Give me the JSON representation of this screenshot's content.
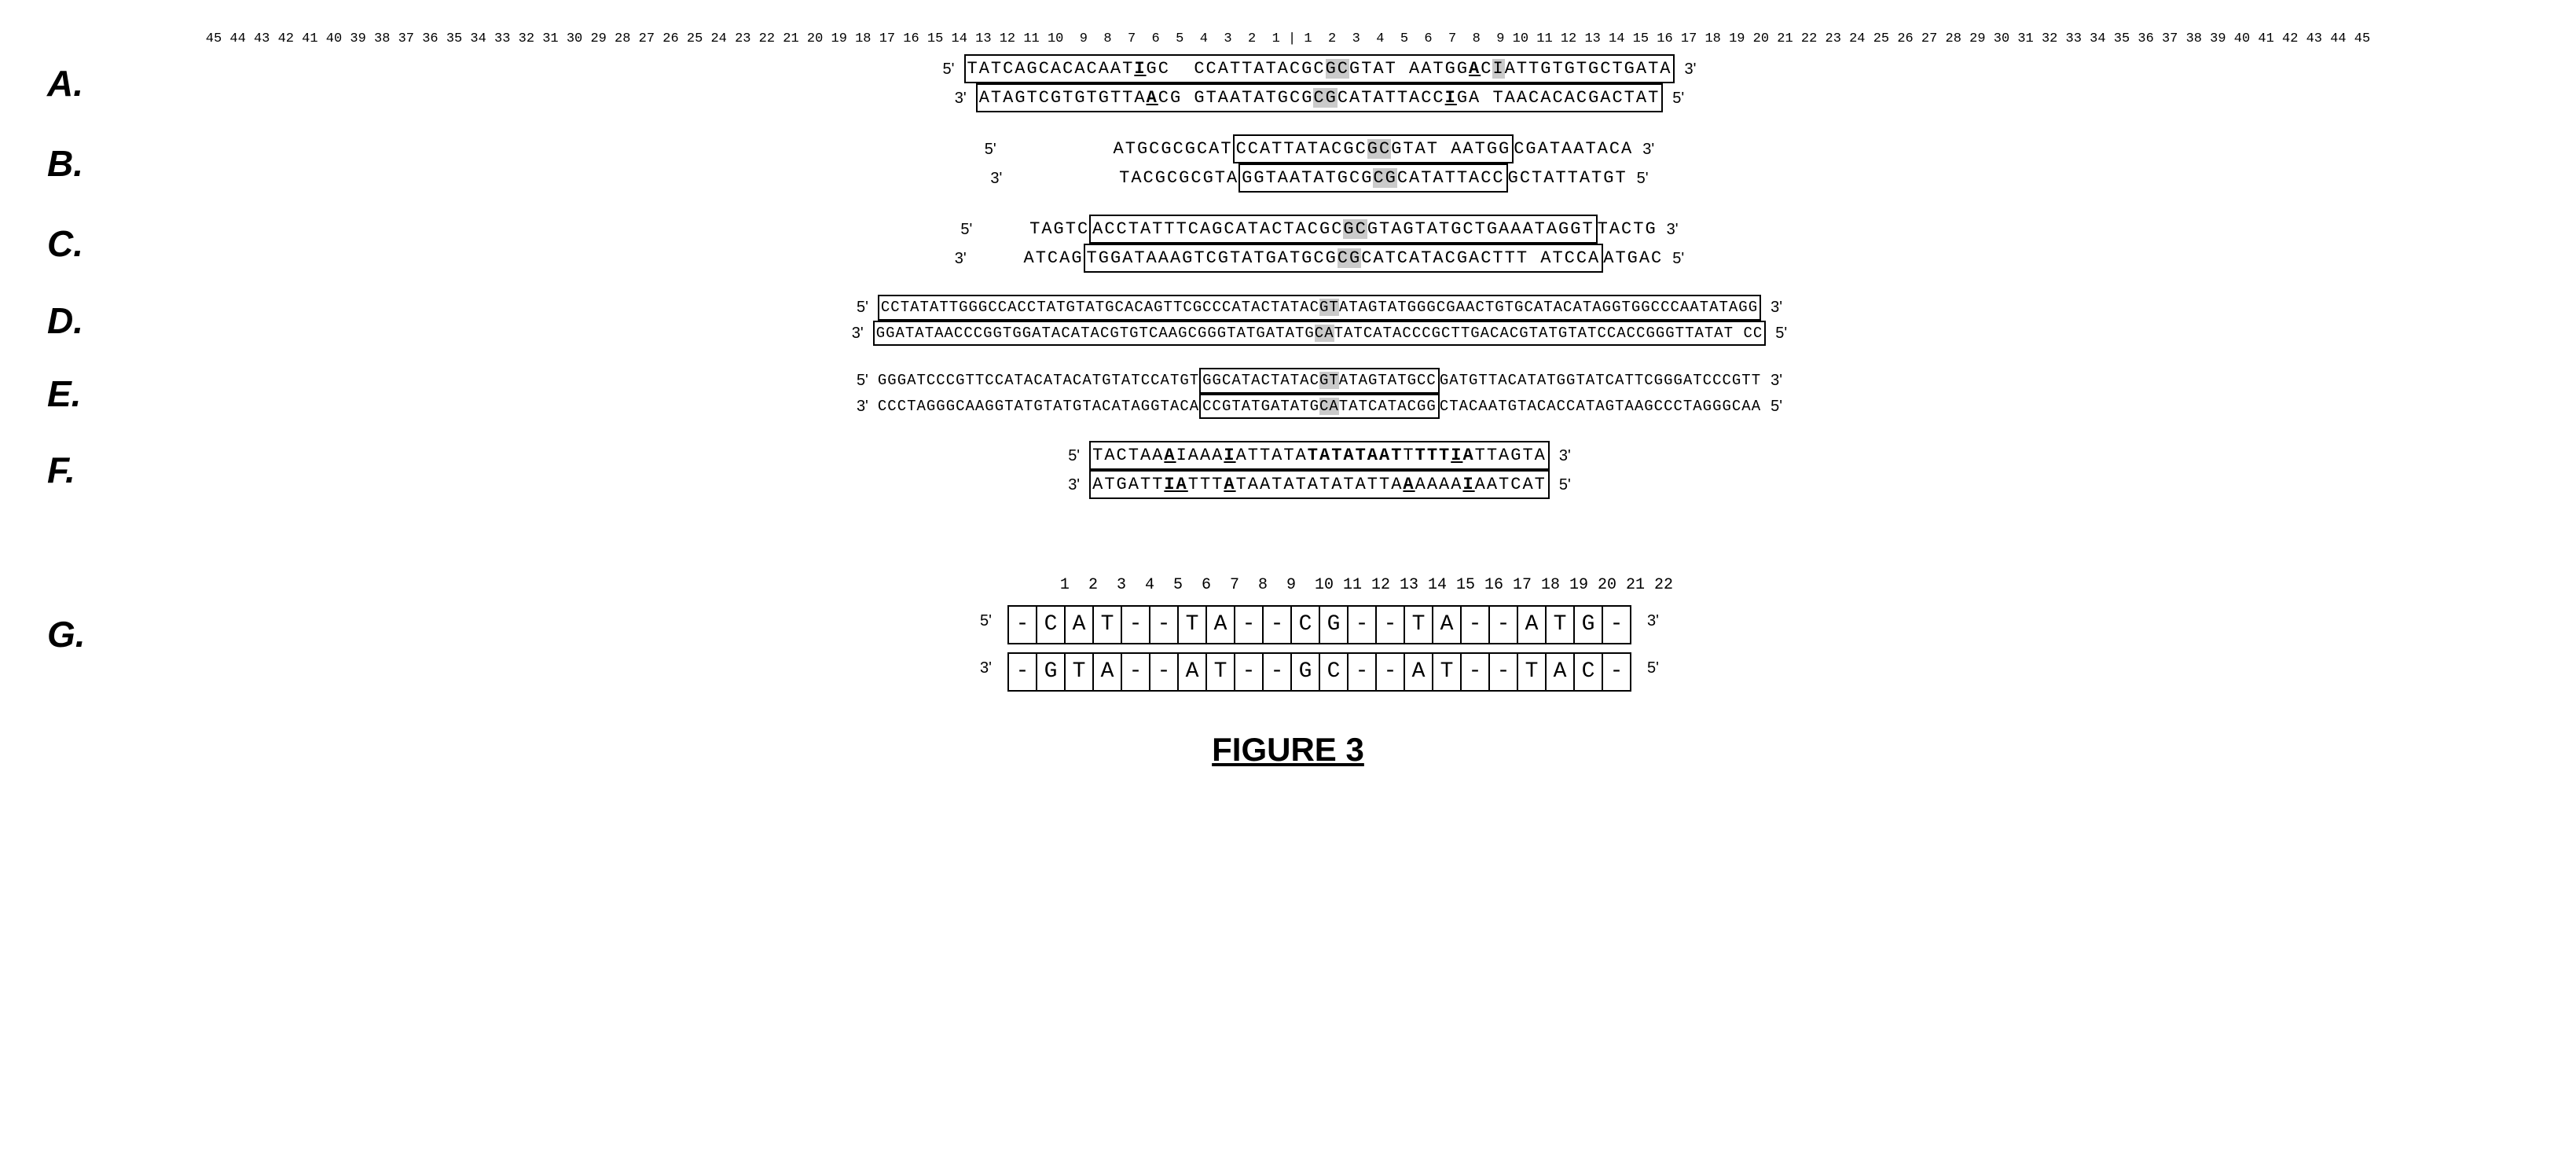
{
  "figure": {
    "title": "FIGURE 3",
    "ruler_top": "45 44 43 42 41 40 39 38 37 36 35 34 33 32 31 30 29 28 27 26 25 24 23 22 21 20 19 18 17 16 15 14 13 12 11 10  9  8  7  6  5  4  3  2  1 | 1  2  3  4  5  6  7  8  9 10 11 12 13 14 15 16 17 18 19 20 21 22 23 24 25 26 27 28 29 30 31 32 33 34 35 36 37 38 39 40 41 42 43 44 45",
    "sections": {
      "A": {
        "label": "A.",
        "top_strand": "5'   TATCAGCACACAAT|GC|CCATTATACGC|GCGTAT AATGG|AC|IATTGTGTGCTGATA   3'",
        "bottom_strand": "3'   ATAGTCGTGTGTTA|ACG|GTAATATGCGCGCATATTACC|IGA|TAACACACGACTAT   5'"
      },
      "B": {
        "label": "B.",
        "top_strand": "5'        ATGCGCGCAT|CCATTATACGC|GCGTAT AATGG|CGATAATACA   3'",
        "bottom_strand": "3'        TACGCGCGTA|GGTAATATGCGCGCATATTACC|GCTATTATGT   5'"
      },
      "C": {
        "label": "C.",
        "top_strand": "5'    TAGTC|ACCTATTTCAGCATACTACGC|GCGTAGTATGCTGAAATAGGT|TACTG   3'",
        "bottom_strand": "3'    ATCAG|TGGATAAAGTCGTATGATGCGCGCATCATACGACTTT ATCCA|ATGAC   5'"
      },
      "D": {
        "label": "D.",
        "top_5": "5'",
        "top_strand": "CCTATATTGGGCCACCTATGTATGCACAGTTCGCCCATACTATACGTATAGTATGGGCGAACTGTGCATACATAGGTGGCCCAATATAGG",
        "top_3": "3'",
        "bottom_5": "5'",
        "bottom_strand": "GGATATAACCCGGTGGATACATACGTGTCAAGCGGGTATGATATGCATATCATACCCGCTTGACACGTATGTATCCACCGGGTTATAT CC",
        "bottom_3": "3'"
      },
      "E": {
        "label": "E.",
        "top_5": "5'",
        "top_strand": "GGGATCCCGTTCCATACATACATGTATCCATGT|GGCATACTATACGTATAGTATGCC|GATGTTACATATGGTATCATTCGGGATCCCGTT",
        "top_3": "3'",
        "bottom_5": "3'",
        "bottom_strand": "CCCTAGGGCAAGGTATGTATGTACATAGGTACA|CCGTATGATATGCATATCATACGG|CTACAATGTACACCATAGTAAGCCCTAGGGCAA",
        "bottom_3": "5'"
      },
      "F": {
        "label": "F.",
        "top_strand": "5'   TACTAA|A|IAAA|TATTATA|TATATAAT|T|TTT|IA|TTAGTA   3'",
        "bottom_strand": "3'   ATGATT|IA|TTT|ATAATATATATATTA|AAAAA|I|AATCAT   5'"
      },
      "G": {
        "label": "G.",
        "col_numbers": "1  2  3  4  5  6  7  8  9  10 11 12 13 14 15 16 17 18 19 20 21 22",
        "top_5": "5'",
        "top_seq": "-  C  A  T  -  -  T  A  -  -  C  G  -  -  T  A  -  -  A  T  G  -",
        "top_3": "3'",
        "bottom_5": "3'",
        "bottom_seq": "-  G  T  A  -  -  A  T  -  -  G  C  -  -  A  T  -  -  T  A  C  -",
        "bottom_3": "5'"
      }
    }
  }
}
